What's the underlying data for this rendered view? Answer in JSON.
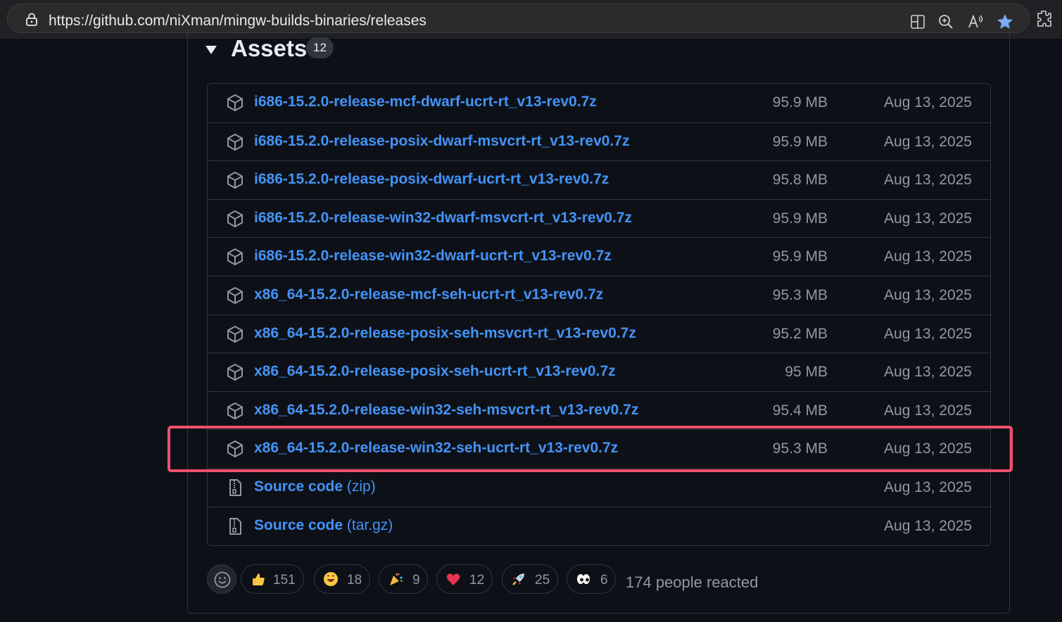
{
  "browser": {
    "url": "https://github.com/niXman/mingw-builds-binaries/releases"
  },
  "assets": {
    "title": "Assets",
    "count": "12",
    "items": [
      {
        "name": "i686-15.2.0-release-mcf-dwarf-ucrt-rt_v13-rev0.7z",
        "size": "95.9 MB",
        "date": "Aug 13, 2025",
        "kind": "package"
      },
      {
        "name": "i686-15.2.0-release-posix-dwarf-msvcrt-rt_v13-rev0.7z",
        "size": "95.9 MB",
        "date": "Aug 13, 2025",
        "kind": "package"
      },
      {
        "name": "i686-15.2.0-release-posix-dwarf-ucrt-rt_v13-rev0.7z",
        "size": "95.8 MB",
        "date": "Aug 13, 2025",
        "kind": "package"
      },
      {
        "name": "i686-15.2.0-release-win32-dwarf-msvcrt-rt_v13-rev0.7z",
        "size": "95.9 MB",
        "date": "Aug 13, 2025",
        "kind": "package"
      },
      {
        "name": "i686-15.2.0-release-win32-dwarf-ucrt-rt_v13-rev0.7z",
        "size": "95.9 MB",
        "date": "Aug 13, 2025",
        "kind": "package"
      },
      {
        "name": "x86_64-15.2.0-release-mcf-seh-ucrt-rt_v13-rev0.7z",
        "size": "95.3 MB",
        "date": "Aug 13, 2025",
        "kind": "package"
      },
      {
        "name": "x86_64-15.2.0-release-posix-seh-msvcrt-rt_v13-rev0.7z",
        "size": "95.2 MB",
        "date": "Aug 13, 2025",
        "kind": "package"
      },
      {
        "name": "x86_64-15.2.0-release-posix-seh-ucrt-rt_v13-rev0.7z",
        "size": "95 MB",
        "date": "Aug 13, 2025",
        "kind": "package"
      },
      {
        "name": "x86_64-15.2.0-release-win32-seh-msvcrt-rt_v13-rev0.7z",
        "size": "95.4 MB",
        "date": "Aug 13, 2025",
        "kind": "package"
      },
      {
        "name": "x86_64-15.2.0-release-win32-seh-ucrt-rt_v13-rev0.7z",
        "size": "95.3 MB",
        "date": "Aug 13, 2025",
        "kind": "package",
        "highlighted": true
      },
      {
        "name": "Source code",
        "ext": "(zip)",
        "size": "",
        "date": "Aug 13, 2025",
        "kind": "zip"
      },
      {
        "name": "Source code",
        "ext": "(tar.gz)",
        "size": "",
        "date": "Aug 13, 2025",
        "kind": "zip"
      }
    ]
  },
  "reactions": {
    "items": [
      {
        "emoji": "thumbs-up",
        "count": "151"
      },
      {
        "emoji": "laugh",
        "count": "18"
      },
      {
        "emoji": "hooray",
        "count": "9"
      },
      {
        "emoji": "heart",
        "count": "12"
      },
      {
        "emoji": "rocket",
        "count": "25"
      },
      {
        "emoji": "eyes",
        "count": "6"
      }
    ],
    "summary": "174 people reacted"
  },
  "colors": {
    "link": "#4493f8",
    "muted": "#9198a1",
    "border": "#30363d",
    "highlight": "#f0506e"
  }
}
